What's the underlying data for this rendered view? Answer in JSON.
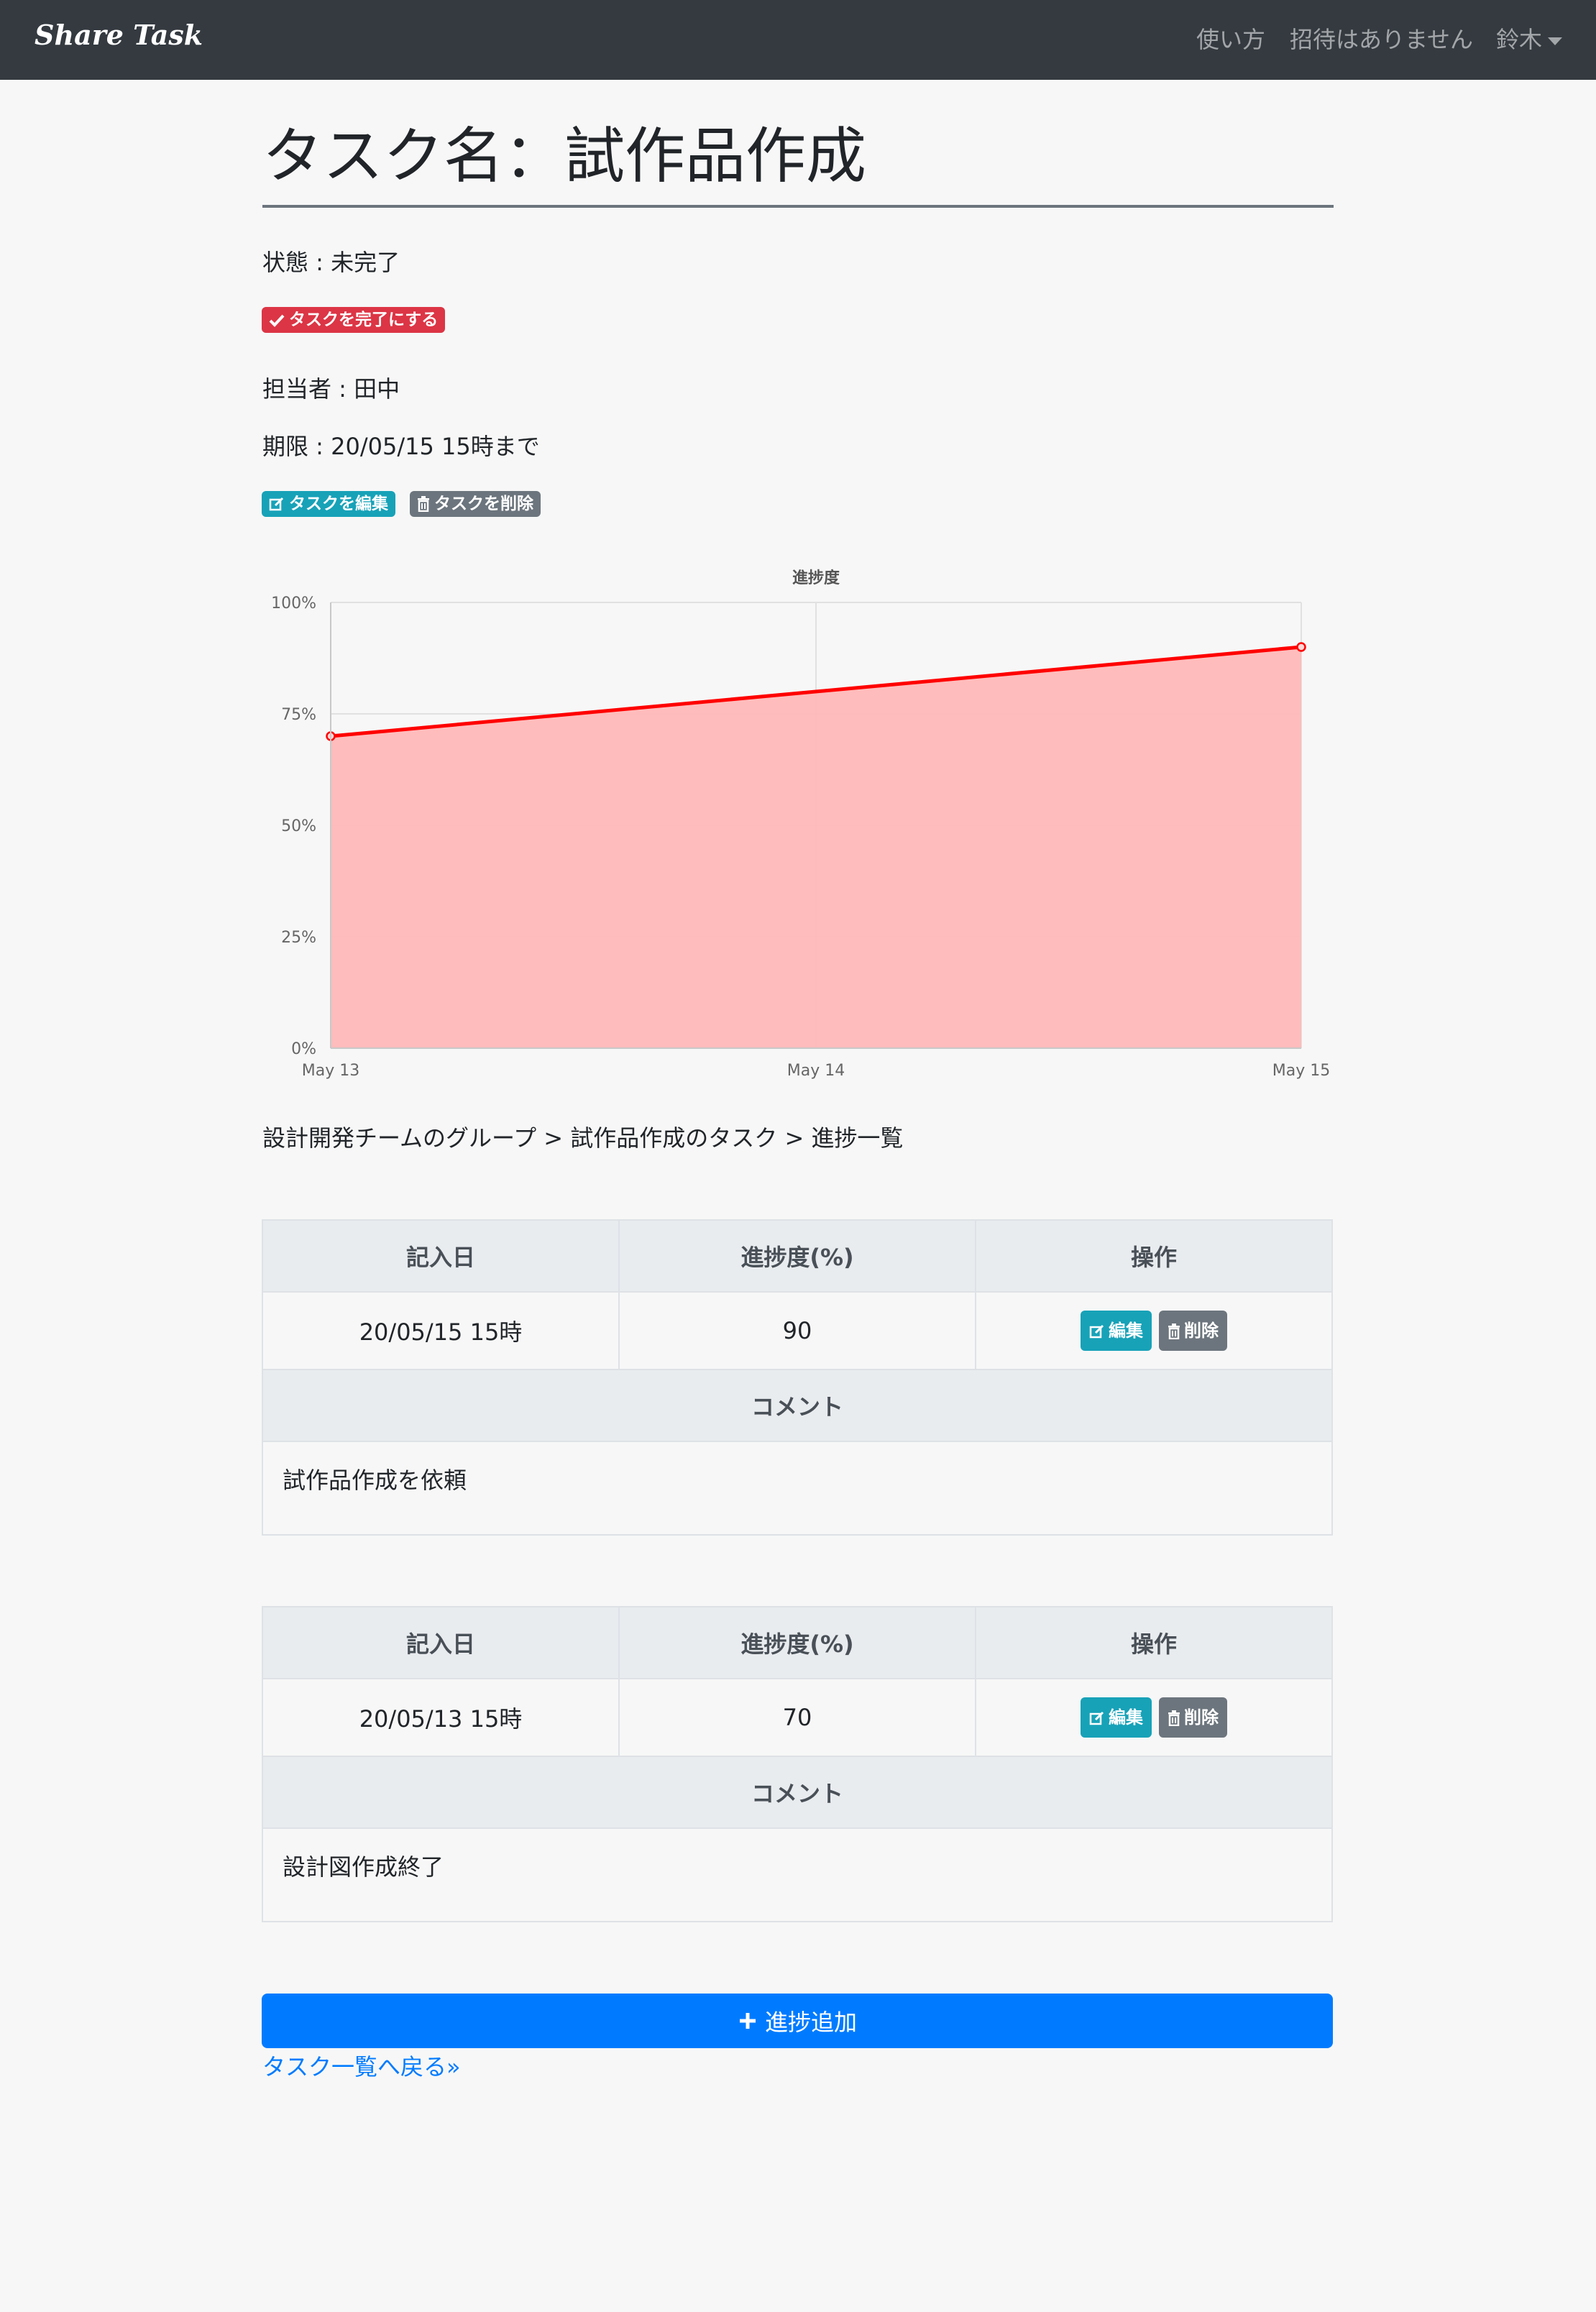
{
  "navbar": {
    "brand": "Share Task",
    "howto": "使い方",
    "invite": "招待はありません",
    "user": "鈴木"
  },
  "task": {
    "title": "タスク名：試作品作成",
    "status": "状態 : 未完了",
    "complete_button": "タスクを完了にする",
    "assignee": "担当者 : 田中",
    "deadline": "期限 : 20/05/15 15時まで",
    "edit_button": "タスクを編集",
    "delete_button": "タスクを削除"
  },
  "chart_data": {
    "type": "area",
    "title": "進捗度",
    "x": [
      "May 13",
      "May 14",
      "May 15"
    ],
    "y_ticks": [
      "0%",
      "25%",
      "50%",
      "75%",
      "100%"
    ],
    "ylim": [
      0,
      100
    ],
    "series": [
      {
        "x": [
          "May 13",
          "May 15"
        ],
        "values": [
          70,
          90
        ]
      }
    ],
    "grid": true,
    "colors": {
      "line": "#ff0000",
      "fill": "#ffb8b8"
    }
  },
  "breadcrumb": "設計開発チームのグループ > 試作品作成のタスク > 進捗一覧",
  "table_headers": {
    "date": "記入日",
    "progress": "進捗度(%)",
    "actions": "操作",
    "comment": "コメント",
    "edit": "編集",
    "delete": "削除"
  },
  "progress_entries": [
    {
      "date": "20/05/15 15時",
      "progress": "90",
      "comment": "試作品作成を依頼"
    },
    {
      "date": "20/05/13 15時",
      "progress": "70",
      "comment": "設計図作成終了"
    }
  ],
  "add_button": "進捗追加",
  "back_link": "タスク一覧へ戻る»",
  "colors": {
    "navbar": "#343a40",
    "primary": "#007bff",
    "danger": "#dc3545",
    "info": "#17a2b8",
    "secondary": "#6c757d"
  }
}
